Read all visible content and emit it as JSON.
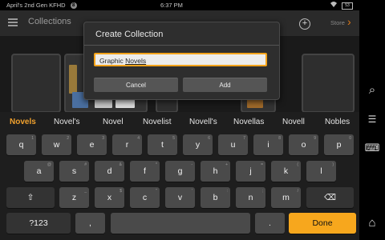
{
  "status": {
    "device_name": "April's 2nd Gen KFHD",
    "notification_count": "8",
    "time": "6:37 PM",
    "battery": "53"
  },
  "topbar": {
    "title": "Collections",
    "store_label": "Store",
    "plus_label": "+"
  },
  "dialog": {
    "title": "Create Collection",
    "input_value_plain": "Graphic ",
    "input_value_underlined": "Novels",
    "cancel_label": "Cancel",
    "add_label": "Add"
  },
  "keyboard": {
    "suggestions": [
      "Novels",
      "Novel's",
      "Novel",
      "Novelist",
      "Novell's",
      "Novellas",
      "Novell",
      "Nobles"
    ],
    "row1": [
      {
        "k": "q",
        "hint": "1"
      },
      {
        "k": "w",
        "hint": "2"
      },
      {
        "k": "e",
        "hint": "3"
      },
      {
        "k": "r",
        "hint": "4"
      },
      {
        "k": "t",
        "hint": "5"
      },
      {
        "k": "y",
        "hint": "6"
      },
      {
        "k": "u",
        "hint": "7"
      },
      {
        "k": "i",
        "hint": "8"
      },
      {
        "k": "o",
        "hint": "9"
      },
      {
        "k": "p",
        "hint": "0"
      }
    ],
    "row2": [
      {
        "k": "a",
        "hint": "@"
      },
      {
        "k": "s",
        "hint": "#"
      },
      {
        "k": "d",
        "hint": "&"
      },
      {
        "k": "f",
        "hint": "*"
      },
      {
        "k": "g",
        "hint": "-"
      },
      {
        "k": "h",
        "hint": "+"
      },
      {
        "k": "j",
        "hint": "="
      },
      {
        "k": "k",
        "hint": "("
      },
      {
        "k": "l",
        "hint": ")"
      }
    ],
    "row3": [
      {
        "k": "z",
        "hint": "_"
      },
      {
        "k": "x",
        "hint": "$"
      },
      {
        "k": "c",
        "hint": "\""
      },
      {
        "k": "v",
        "hint": "'"
      },
      {
        "k": "b",
        "hint": ":"
      },
      {
        "k": "n",
        "hint": ";"
      },
      {
        "k": "m",
        "hint": "/"
      }
    ],
    "shift_glyph": "⇧",
    "backspace_glyph": "⌫",
    "symbols_label": "?123",
    "comma_label": ",",
    "period_label": ".",
    "done_label": "Done"
  },
  "sidebar": {
    "search_glyph": "⌕",
    "notes_glyph": "☰",
    "keyboard_glyph": "⌨",
    "home_glyph": "⌂"
  },
  "colors": {
    "accent": "#f7a71d",
    "suggestion_active": "#f0a12e",
    "key": "#4a4a4a"
  }
}
